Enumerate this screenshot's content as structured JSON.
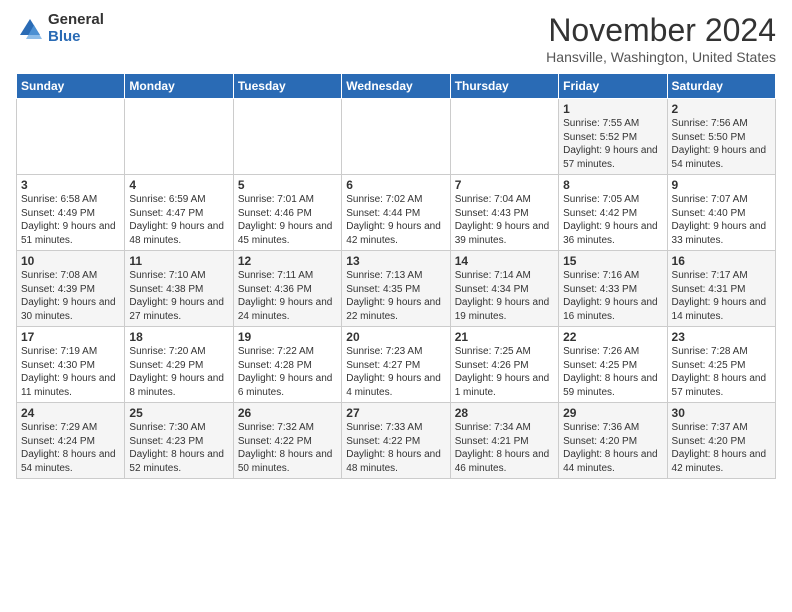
{
  "logo": {
    "general": "General",
    "blue": "Blue"
  },
  "title": "November 2024",
  "subtitle": "Hansville, Washington, United States",
  "days_of_week": [
    "Sunday",
    "Monday",
    "Tuesday",
    "Wednesday",
    "Thursday",
    "Friday",
    "Saturday"
  ],
  "weeks": [
    [
      {
        "day": "",
        "info": ""
      },
      {
        "day": "",
        "info": ""
      },
      {
        "day": "",
        "info": ""
      },
      {
        "day": "",
        "info": ""
      },
      {
        "day": "",
        "info": ""
      },
      {
        "day": "1",
        "info": "Sunrise: 7:55 AM\nSunset: 5:52 PM\nDaylight: 9 hours and 57 minutes."
      },
      {
        "day": "2",
        "info": "Sunrise: 7:56 AM\nSunset: 5:50 PM\nDaylight: 9 hours and 54 minutes."
      }
    ],
    [
      {
        "day": "3",
        "info": "Sunrise: 6:58 AM\nSunset: 4:49 PM\nDaylight: 9 hours and 51 minutes."
      },
      {
        "day": "4",
        "info": "Sunrise: 6:59 AM\nSunset: 4:47 PM\nDaylight: 9 hours and 48 minutes."
      },
      {
        "day": "5",
        "info": "Sunrise: 7:01 AM\nSunset: 4:46 PM\nDaylight: 9 hours and 45 minutes."
      },
      {
        "day": "6",
        "info": "Sunrise: 7:02 AM\nSunset: 4:44 PM\nDaylight: 9 hours and 42 minutes."
      },
      {
        "day": "7",
        "info": "Sunrise: 7:04 AM\nSunset: 4:43 PM\nDaylight: 9 hours and 39 minutes."
      },
      {
        "day": "8",
        "info": "Sunrise: 7:05 AM\nSunset: 4:42 PM\nDaylight: 9 hours and 36 minutes."
      },
      {
        "day": "9",
        "info": "Sunrise: 7:07 AM\nSunset: 4:40 PM\nDaylight: 9 hours and 33 minutes."
      }
    ],
    [
      {
        "day": "10",
        "info": "Sunrise: 7:08 AM\nSunset: 4:39 PM\nDaylight: 9 hours and 30 minutes."
      },
      {
        "day": "11",
        "info": "Sunrise: 7:10 AM\nSunset: 4:38 PM\nDaylight: 9 hours and 27 minutes."
      },
      {
        "day": "12",
        "info": "Sunrise: 7:11 AM\nSunset: 4:36 PM\nDaylight: 9 hours and 24 minutes."
      },
      {
        "day": "13",
        "info": "Sunrise: 7:13 AM\nSunset: 4:35 PM\nDaylight: 9 hours and 22 minutes."
      },
      {
        "day": "14",
        "info": "Sunrise: 7:14 AM\nSunset: 4:34 PM\nDaylight: 9 hours and 19 minutes."
      },
      {
        "day": "15",
        "info": "Sunrise: 7:16 AM\nSunset: 4:33 PM\nDaylight: 9 hours and 16 minutes."
      },
      {
        "day": "16",
        "info": "Sunrise: 7:17 AM\nSunset: 4:31 PM\nDaylight: 9 hours and 14 minutes."
      }
    ],
    [
      {
        "day": "17",
        "info": "Sunrise: 7:19 AM\nSunset: 4:30 PM\nDaylight: 9 hours and 11 minutes."
      },
      {
        "day": "18",
        "info": "Sunrise: 7:20 AM\nSunset: 4:29 PM\nDaylight: 9 hours and 8 minutes."
      },
      {
        "day": "19",
        "info": "Sunrise: 7:22 AM\nSunset: 4:28 PM\nDaylight: 9 hours and 6 minutes."
      },
      {
        "day": "20",
        "info": "Sunrise: 7:23 AM\nSunset: 4:27 PM\nDaylight: 9 hours and 4 minutes."
      },
      {
        "day": "21",
        "info": "Sunrise: 7:25 AM\nSunset: 4:26 PM\nDaylight: 9 hours and 1 minute."
      },
      {
        "day": "22",
        "info": "Sunrise: 7:26 AM\nSunset: 4:25 PM\nDaylight: 8 hours and 59 minutes."
      },
      {
        "day": "23",
        "info": "Sunrise: 7:28 AM\nSunset: 4:25 PM\nDaylight: 8 hours and 57 minutes."
      }
    ],
    [
      {
        "day": "24",
        "info": "Sunrise: 7:29 AM\nSunset: 4:24 PM\nDaylight: 8 hours and 54 minutes."
      },
      {
        "day": "25",
        "info": "Sunrise: 7:30 AM\nSunset: 4:23 PM\nDaylight: 8 hours and 52 minutes."
      },
      {
        "day": "26",
        "info": "Sunrise: 7:32 AM\nSunset: 4:22 PM\nDaylight: 8 hours and 50 minutes."
      },
      {
        "day": "27",
        "info": "Sunrise: 7:33 AM\nSunset: 4:22 PM\nDaylight: 8 hours and 48 minutes."
      },
      {
        "day": "28",
        "info": "Sunrise: 7:34 AM\nSunset: 4:21 PM\nDaylight: 8 hours and 46 minutes."
      },
      {
        "day": "29",
        "info": "Sunrise: 7:36 AM\nSunset: 4:20 PM\nDaylight: 8 hours and 44 minutes."
      },
      {
        "day": "30",
        "info": "Sunrise: 7:37 AM\nSunset: 4:20 PM\nDaylight: 8 hours and 42 minutes."
      }
    ]
  ]
}
